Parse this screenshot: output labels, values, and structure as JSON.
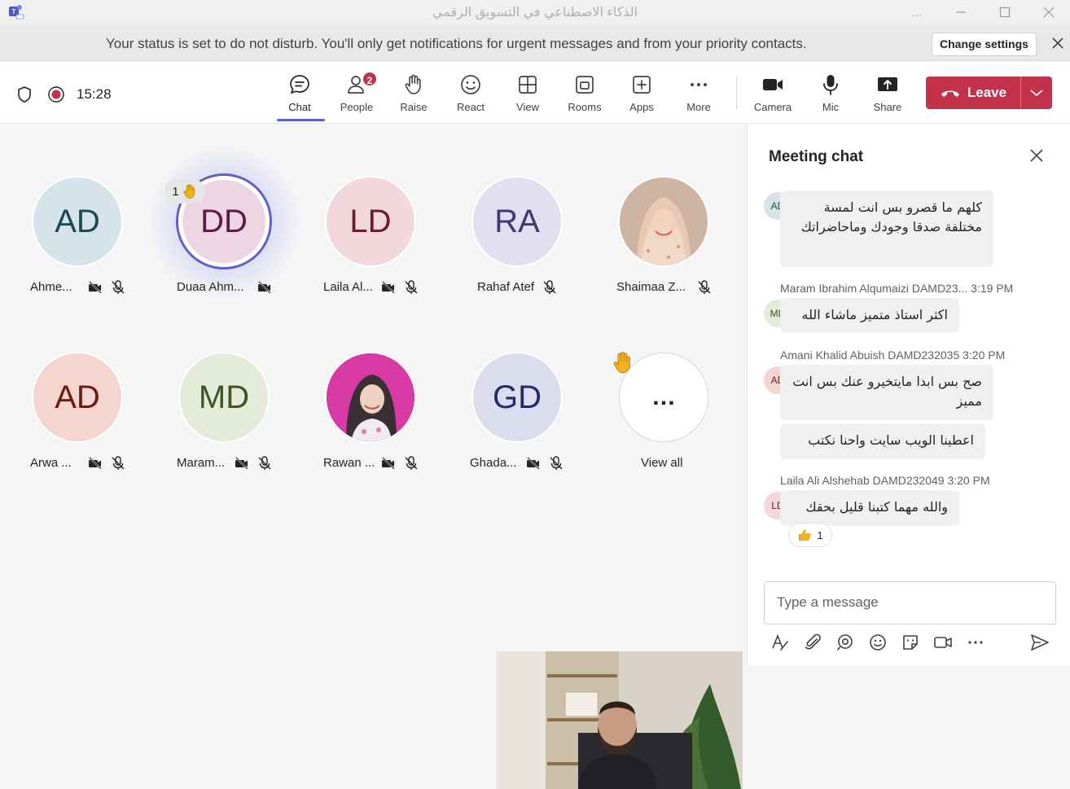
{
  "window": {
    "title": "الذكاء الاصطناعي في التسويق الرقمي",
    "more": "…"
  },
  "status_banner": {
    "message": "Your status is set to do not disturb. You'll only get notifications for urgent messages and from your priority contacts.",
    "change_settings": "Change settings"
  },
  "toolbar": {
    "timer": "15:28",
    "items": [
      {
        "label": "Chat",
        "icon": "chat-icon"
      },
      {
        "label": "People",
        "icon": "people-icon",
        "badge": "2"
      },
      {
        "label": "Raise",
        "icon": "raise-hand-icon"
      },
      {
        "label": "React",
        "icon": "react-icon"
      },
      {
        "label": "View",
        "icon": "view-icon"
      },
      {
        "label": "Rooms",
        "icon": "rooms-icon"
      },
      {
        "label": "Apps",
        "icon": "apps-icon"
      },
      {
        "label": "More",
        "icon": "more-icon"
      },
      {
        "label": "Camera",
        "icon": "camera-icon"
      },
      {
        "label": "Mic",
        "icon": "mic-icon"
      },
      {
        "label": "Share",
        "icon": "share-icon"
      }
    ],
    "leave": "Leave"
  },
  "participants": [
    {
      "initials": "AD",
      "name": "Ahme...",
      "bg": "#d6e4ea",
      "fg": "#1e4757"
    },
    {
      "initials": "DD",
      "name": "Duaa Ahm...",
      "bg": "#edd6e4",
      "fg": "#5b1b44",
      "hand_count": "1"
    },
    {
      "initials": "LD",
      "name": "Laila Al...",
      "bg": "#f0d8dc",
      "fg": "#6e1a27"
    },
    {
      "initials": "RA",
      "name": "Rahaf Atef",
      "bg": "#e3dff0",
      "fg": "#3f3a72"
    },
    {
      "initials": "",
      "name": "Shaimaa Z...",
      "bg": "#d7b9a7",
      "fg": "#333"
    },
    {
      "initials": "AD",
      "name": "Arwa ...",
      "bg": "#f4d6cf",
      "fg": "#6a1d0f"
    },
    {
      "initials": "MD",
      "name": "Maram...",
      "bg": "#e4ecd9",
      "fg": "#3d5526"
    },
    {
      "initials": "",
      "name": "Rawan ...",
      "bg": "#d83aa5",
      "fg": "#333"
    },
    {
      "initials": "GD",
      "name": "Ghada...",
      "bg": "#dcdcef",
      "fg": "#252a66"
    }
  ],
  "view_all": {
    "label": "View all",
    "glyph": "…"
  },
  "chat": {
    "title": "Meeting chat",
    "messages": [
      {
        "initials": "AD",
        "avatar_bg": "#d6e4ea",
        "avatar_fg": "#1e4757",
        "meta": "",
        "text": "كلهم ما قصرو بس انت لمسة مختلفة صدقا وجودك وماحاضراتك"
      },
      {
        "initials": "MD",
        "avatar_bg": "#e4ecd9",
        "avatar_fg": "#3d5526",
        "meta": "Maram Ibrahim Alqumaizi DAMD23...   3:19 PM",
        "text": "اكثر استاذ متميز ماشاء الله"
      },
      {
        "initials": "AD",
        "avatar_bg": "#f4d6cf",
        "avatar_fg": "#6a1d0f",
        "meta": "Amani Khalid Abuish DAMD232035   3:20 PM",
        "text": "صح بس ابدا مايتخيرو عنك بس انت مميز",
        "text2": "اعطينا الويب سايت واحنا نكتب"
      },
      {
        "initials": "LD",
        "avatar_bg": "#f0d8dc",
        "avatar_fg": "#6e1a27",
        "meta": "Laila Ali Alshehab DAMD232049   3:20 PM",
        "text": "والله مهما كتبنا قليل بحقك",
        "reaction_count": "1"
      }
    ],
    "compose_placeholder": "Type a message"
  },
  "colors": {
    "accent": "#5b5fc7",
    "leave": "#c4314b",
    "badge": "#c4314b",
    "presence_dnd": "#d13438"
  }
}
